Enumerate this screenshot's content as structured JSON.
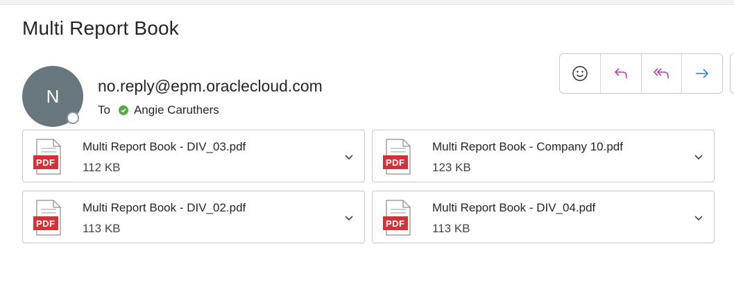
{
  "email": {
    "subject": "Multi Report Book",
    "sender": {
      "initial": "N",
      "address": "no.reply@epm.oraclecloud.com"
    },
    "to_label": "To",
    "recipient": "Angie Caruthers"
  },
  "toolbar": {
    "buttons": [
      {
        "name": "emoji-react",
        "icon": "smiley-icon"
      },
      {
        "name": "reply",
        "icon": "reply-icon"
      },
      {
        "name": "reply-all",
        "icon": "reply-all-icon"
      },
      {
        "name": "forward",
        "icon": "forward-icon"
      }
    ]
  },
  "attachments": [
    {
      "name": "Multi Report Book - DIV_03.pdf",
      "size": "112 KB",
      "type": "PDF"
    },
    {
      "name": "Multi Report Book - Company 10.pdf",
      "size": "123 KB",
      "type": "PDF"
    },
    {
      "name": "Multi Report Book - DIV_02.pdf",
      "size": "113 KB",
      "type": "PDF"
    },
    {
      "name": "Multi Report Book - DIV_04.pdf",
      "size": "113 KB",
      "type": "PDF"
    }
  ],
  "colors": {
    "avatar": "#68767e",
    "reply_accent": "#b43fb4",
    "forward_accent": "#2f7fc4",
    "pdf_red": "#d13438",
    "presence_available": "#5aa84a"
  }
}
